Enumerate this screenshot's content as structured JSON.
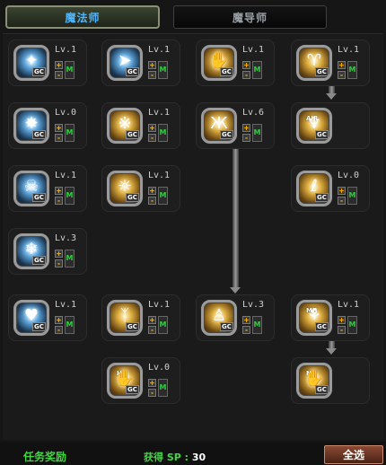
{
  "tabs": {
    "active": "魔法师",
    "inactive": "魔导师"
  },
  "skills": [
    {
      "id": "s1",
      "level": "Lv.1",
      "glyph": "✦",
      "icon": "ice-burst-icon",
      "style": "blue",
      "gc": "GC",
      "plus": "+",
      "minus": "-",
      "m": "M"
    },
    {
      "id": "s2",
      "level": "Lv.1",
      "glyph": "➤",
      "icon": "ice-spear-icon",
      "style": "blue",
      "gc": "GC",
      "plus": "+",
      "minus": "-",
      "m": "M"
    },
    {
      "id": "s3",
      "level": "Lv.1",
      "glyph": "✋",
      "icon": "fire-hand-icon",
      "style": "gold",
      "gc": "GC",
      "plus": "+",
      "minus": "-",
      "m": "M"
    },
    {
      "id": "s4",
      "level": "Lv.1",
      "glyph": "♈",
      "icon": "horned-beast-icon",
      "style": "gold",
      "gc": "GC",
      "plus": "+",
      "minus": "-",
      "m": "M"
    },
    {
      "id": "s5",
      "level": "Lv.0",
      "glyph": "✸",
      "icon": "frost-star-icon",
      "style": "blue",
      "gc": "GC",
      "plus": "+",
      "minus": "-",
      "m": "M"
    },
    {
      "id": "s6",
      "level": "Lv.1",
      "glyph": "※",
      "icon": "fire-swirl-icon",
      "style": "gold",
      "gc": "GC",
      "plus": "+",
      "minus": "-",
      "m": "M"
    },
    {
      "id": "s7",
      "level": "Lv.6",
      "glyph": "Ж",
      "icon": "fire-burst-icon",
      "style": "gold",
      "gc": "GC",
      "plus": "+",
      "minus": "-",
      "m": "M"
    },
    {
      "id": "s8",
      "level": "",
      "glyph": "♆",
      "icon": "air-icon",
      "style": "gold",
      "gc": "GC",
      "badge": "AIR",
      "plus": "",
      "minus": "",
      "m": ""
    },
    {
      "id": "s9",
      "level": "Lv.1",
      "glyph": "☠",
      "icon": "ice-skull-icon",
      "style": "blue",
      "gc": "GC",
      "plus": "+",
      "minus": "-",
      "m": "M"
    },
    {
      "id": "s10",
      "level": "Lv.1",
      "glyph": "☼",
      "icon": "sun-sigil-icon",
      "style": "gold",
      "gc": "GC",
      "plus": "+",
      "minus": "-",
      "m": "M"
    },
    {
      "id": "s11",
      "level": "Lv.0",
      "glyph": "ℓ",
      "icon": "fire-claw-icon",
      "style": "gold",
      "gc": "GC",
      "plus": "+",
      "minus": "-",
      "m": "M"
    },
    {
      "id": "s12",
      "level": "Lv.3",
      "glyph": "❄",
      "icon": "frost-nova-icon",
      "style": "blue",
      "gc": "GC",
      "plus": "+",
      "minus": "-",
      "m": "M"
    },
    {
      "id": "s13",
      "level": "Lv.1",
      "glyph": "♥",
      "icon": "ice-heart-icon",
      "style": "blue",
      "gc": "GC",
      "plus": "+",
      "minus": "-",
      "m": "M"
    },
    {
      "id": "s14",
      "level": "Lv.1",
      "glyph": "ᛉ",
      "icon": "fire-figure-icon",
      "style": "gold",
      "gc": "GC",
      "plus": "+",
      "minus": "-",
      "m": "M"
    },
    {
      "id": "s15",
      "level": "Lv.3",
      "glyph": "♙",
      "icon": "fire-person-icon",
      "style": "gold",
      "gc": "GC",
      "plus": "+",
      "minus": "-",
      "m": "M"
    },
    {
      "id": "s16",
      "level": "Lv.1",
      "glyph": "⚘",
      "icon": "mp-hand-icon",
      "style": "gold",
      "gc": "GC",
      "badge": "MP",
      "plus": "+",
      "minus": "-",
      "m": "M"
    },
    {
      "id": "s17",
      "level": "Lv.0",
      "glyph": "✋",
      "icon": "hp-hand-icon",
      "style": "gold",
      "gc": "GC",
      "badge": "HP",
      "plus": "+",
      "minus": "-",
      "m": "M"
    },
    {
      "id": "s18",
      "level": "",
      "glyph": "✋",
      "icon": "mp-hand-icon",
      "style": "gold",
      "gc": "GC",
      "badge": "MP",
      "plus": "",
      "minus": "",
      "m": ""
    }
  ],
  "footer": {
    "quest_reward": "任务奖励",
    "sp_label": "获得 SP :",
    "sp_value": "30",
    "select_all": "全选"
  }
}
